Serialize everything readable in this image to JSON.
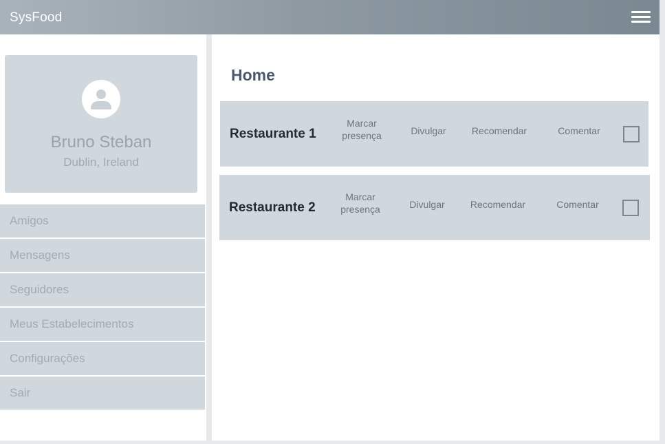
{
  "header": {
    "app_title": "SysFood",
    "menu_icon": "hamburger-menu-icon"
  },
  "profile": {
    "avatar_icon": "user-avatar-icon",
    "name": "Bruno Steban",
    "location": "Dublin, Ireland"
  },
  "sidebar": {
    "items": [
      {
        "label": "Amigos"
      },
      {
        "label": "Mensagens"
      },
      {
        "label": "Seguidores"
      },
      {
        "label": "Meus Estabelecimentos"
      },
      {
        "label": "Configurações"
      },
      {
        "label": "Sair"
      }
    ]
  },
  "main": {
    "title": "Home",
    "restaurants": [
      {
        "name": "Restaurante 1",
        "actions": {
          "marcar_line1": "Marcar",
          "marcar_line2": "presença",
          "divulgar": "Divulgar",
          "recomendar": "Recomendar",
          "comentar": "Comentar"
        },
        "checked": false
      },
      {
        "name": "Restaurante 2",
        "actions": {
          "marcar_line1": "Marcar",
          "marcar_line2": "presença",
          "divulgar": "Divulgar",
          "recomendar": "Recomendar",
          "comentar": "Comentar"
        },
        "checked": false
      }
    ]
  }
}
